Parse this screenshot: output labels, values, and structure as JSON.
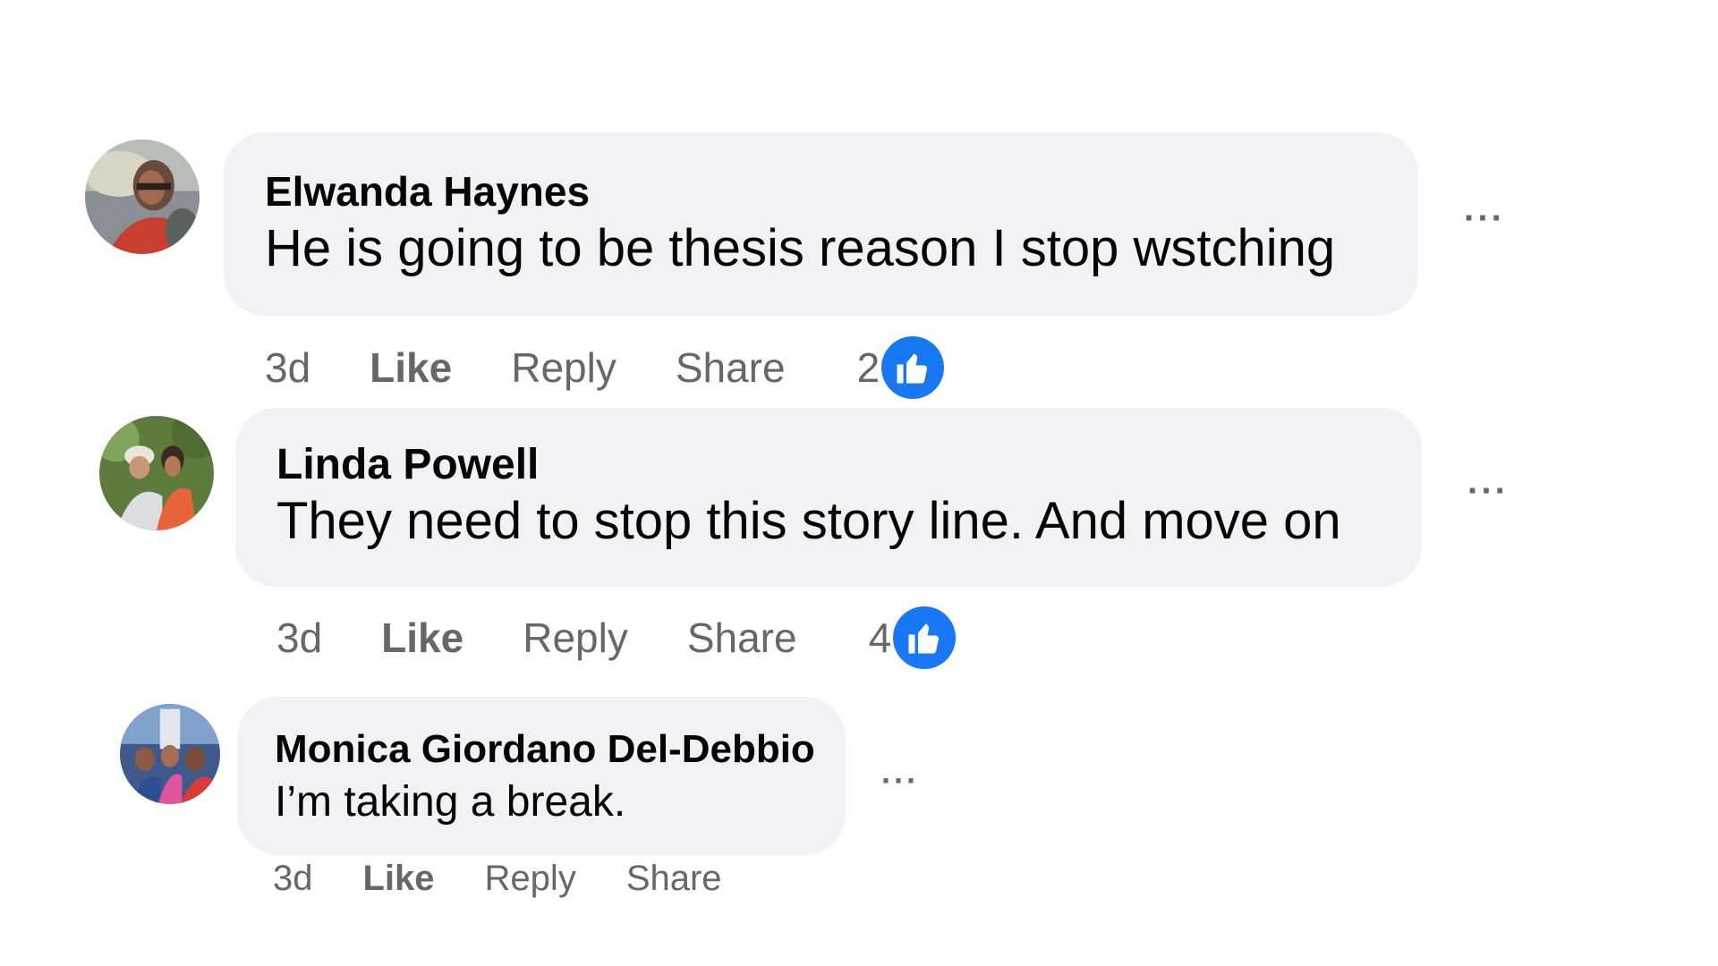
{
  "comments": [
    {
      "author": "Elwanda Haynes",
      "text": "He is going to be thesis reason I stop wstching",
      "time": "3d",
      "like_label": "Like",
      "reply_label": "Reply",
      "share_label": "Share",
      "reaction_count": "2",
      "more_label": "···"
    },
    {
      "author": "Linda Powell",
      "text": "They need to stop this story line. And move on",
      "time": "3d",
      "like_label": "Like",
      "reply_label": "Reply",
      "share_label": "Share",
      "reaction_count": "4",
      "more_label": "···"
    },
    {
      "author": "Monica Giordano Del-Debbio",
      "text": "I’m taking a break.",
      "time": "3d",
      "like_label": "Like",
      "reply_label": "Reply",
      "share_label": "Share",
      "more_label": "···"
    }
  ],
  "colors": {
    "bubble": "#f0f2f5",
    "meta_text": "#65676b",
    "like_blue": "#1877f2"
  },
  "icons": {
    "reaction": "thumbs-up-icon",
    "more": "more-options-icon"
  }
}
